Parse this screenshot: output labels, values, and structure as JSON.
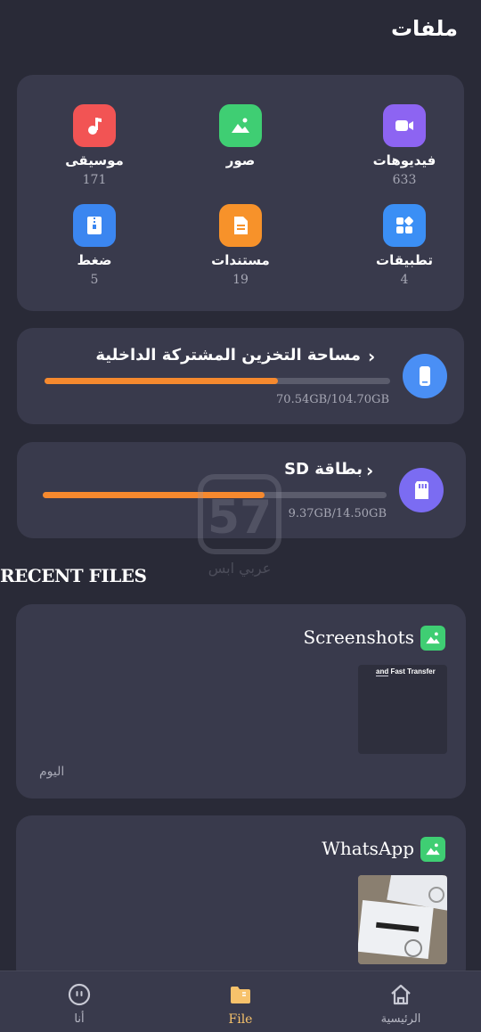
{
  "header": {
    "title": "ملفات"
  },
  "categories": [
    {
      "label": "فيديوهات",
      "count": "633",
      "icon": "video-icon",
      "color": "#8d64f2"
    },
    {
      "label": "صور",
      "count": "",
      "icon": "image-icon",
      "color": "#3fce73"
    },
    {
      "label": "موسيقى",
      "count": "171",
      "icon": "music-icon",
      "color": "#f25454"
    },
    {
      "label": "تطبيقات",
      "count": "4",
      "icon": "apps-icon",
      "color": "#3b8ff5"
    },
    {
      "label": "مستندات",
      "count": "19",
      "icon": "document-icon",
      "color": "#f7922a"
    },
    {
      "label": "ضغط",
      "count": "5",
      "icon": "zip-icon",
      "color": "#3b86f0"
    }
  ],
  "storage": {
    "internal": {
      "title": "مساحة التخزين المشتركة الداخلية",
      "size": "70.54GB/104.70GB",
      "used_fraction": 0.674
    },
    "sd": {
      "title": "بطاقة SD",
      "size": "9.37GB/14.50GB",
      "used_fraction": 0.646
    }
  },
  "recent": {
    "heading": "RECENT FILES",
    "folders": [
      {
        "name": "Screenshots",
        "date": "اليوم",
        "thumb_text": "and Fast Transfer"
      },
      {
        "name": "WhatsApp",
        "date": ""
      }
    ]
  },
  "watermark": {
    "text": "عربي ابس"
  },
  "nav": {
    "items": [
      {
        "label": "الرئيسية"
      },
      {
        "label": "File"
      },
      {
        "label": "أنا"
      }
    ]
  },
  "colors": {
    "background": "#292a37",
    "card": "#393a4c",
    "accent": "#f6892e",
    "active_nav": "#f7c26b"
  }
}
